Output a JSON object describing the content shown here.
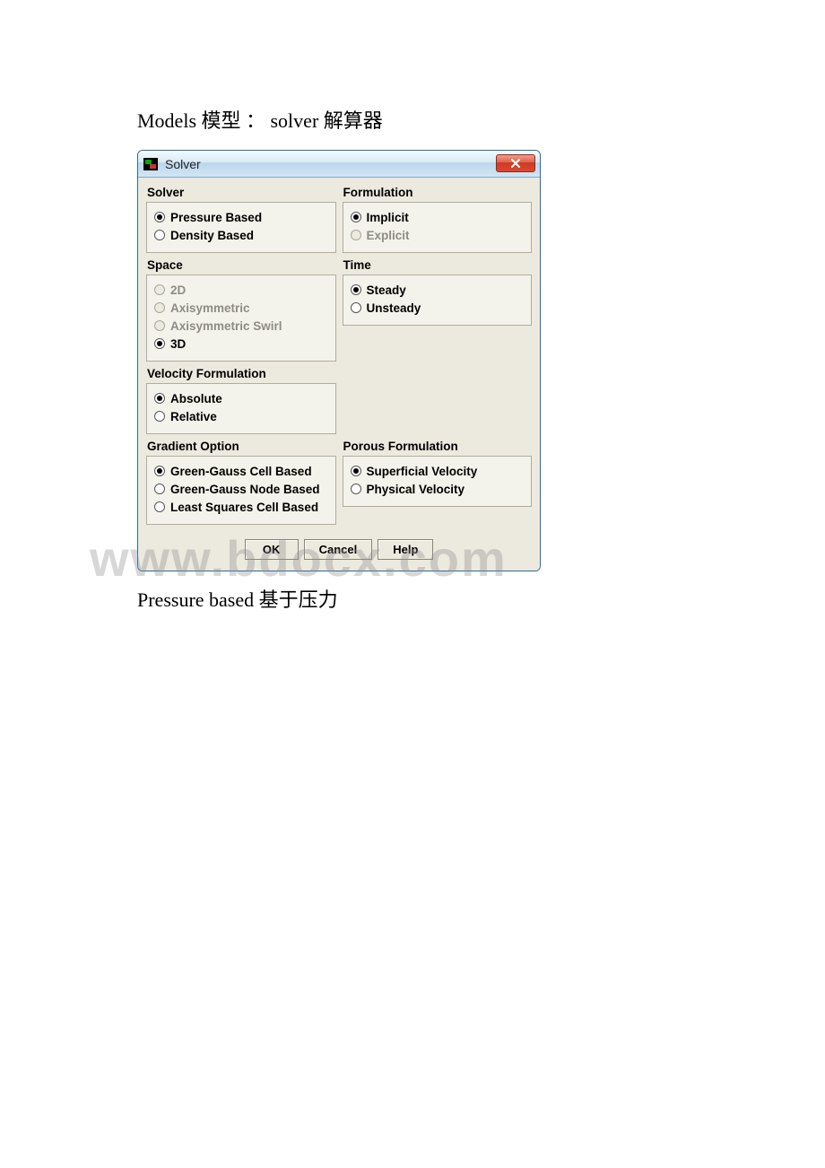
{
  "page": {
    "heading": "Models 模型 ： solver 解算器",
    "footer": "Pressure based 基于压力",
    "watermark": "www.bdocx.com"
  },
  "dialog": {
    "title": "Solver",
    "buttons": {
      "ok": "OK",
      "cancel": "Cancel",
      "help": "Help"
    },
    "groups": {
      "solver": {
        "title": "Solver",
        "options": {
          "pressure": "Pressure Based",
          "density": "Density Based"
        }
      },
      "formulation": {
        "title": "Formulation",
        "options": {
          "implicit": "Implicit",
          "explicit": "Explicit"
        }
      },
      "space": {
        "title": "Space",
        "options": {
          "2d": "2D",
          "axi": "Axisymmetric",
          "axiswirl": "Axisymmetric Swirl",
          "3d": "3D"
        }
      },
      "time": {
        "title": "Time",
        "options": {
          "steady": "Steady",
          "unsteady": "Unsteady"
        }
      },
      "velocity": {
        "title": "Velocity Formulation",
        "options": {
          "absolute": "Absolute",
          "relative": "Relative"
        }
      },
      "gradient": {
        "title": "Gradient Option",
        "options": {
          "ggcell": "Green-Gauss Cell Based",
          "ggnode": "Green-Gauss Node Based",
          "lsq": "Least Squares Cell Based"
        }
      },
      "porous": {
        "title": "Porous Formulation",
        "options": {
          "superficial": "Superficial Velocity",
          "physical": "Physical Velocity"
        }
      }
    }
  }
}
